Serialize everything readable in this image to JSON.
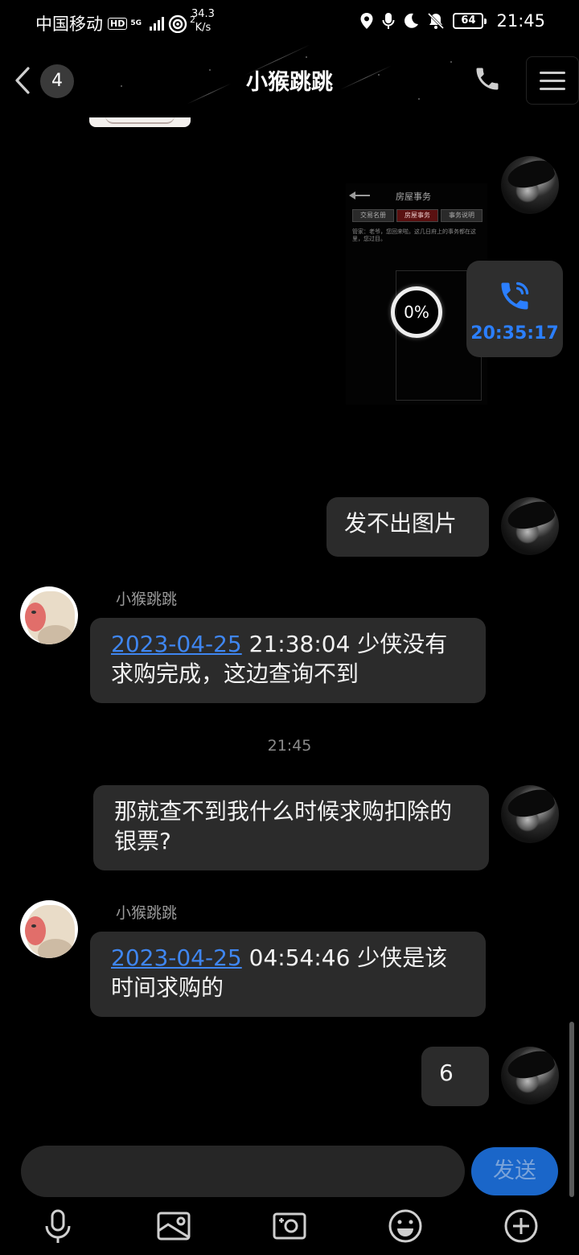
{
  "status_bar": {
    "carrier": "中国移动",
    "hd": "HD",
    "net_gen": "5G",
    "wifi_sub": "2",
    "speed_value": "34.3",
    "speed_unit": "K/s",
    "battery": "64",
    "time": "21:45"
  },
  "header": {
    "unread_count": "4",
    "title": "小猴跳跳",
    "icons": [
      "chevron-left-icon",
      "phone-icon",
      "menu-icon"
    ]
  },
  "chat": {
    "screenshot_preview": {
      "title": "房屋事务",
      "tabs": [
        "交易名册",
        "房屋事务",
        "事务说明"
      ],
      "description": "管家：老爷，您回来啦。这几日府上的事务都在这里，您过目。",
      "upload_progress": "0%"
    },
    "call_record": {
      "duration": "20:35:17"
    },
    "messages": [
      {
        "side": "me",
        "text": "发不出图片"
      },
      {
        "side": "them",
        "sender": "小猴跳跳",
        "link": "2023-04-25",
        "text": " 21:38:04 少侠没有求购完成，这边查询不到"
      },
      {
        "side": "me",
        "text": "那就查不到我什么时候求购扣除的银票?"
      },
      {
        "side": "them",
        "sender": "小猴跳跳",
        "link": "2023-04-25",
        "text": " 04:54:46 少侠是该时间求购的"
      },
      {
        "side": "me",
        "text": "6"
      }
    ],
    "time_separator": "21:45"
  },
  "composer": {
    "placeholder": "",
    "send_label": "发送"
  },
  "toolbar": {
    "items": [
      "microphone-icon",
      "image-icon",
      "camera-icon",
      "emoji-icon",
      "plus-icon"
    ]
  },
  "colors": {
    "background": "#000000",
    "bubble": "#2b2b2b",
    "link": "#3f86f0",
    "send_button": "#1a66c9",
    "call_accent": "#2b7fff"
  }
}
